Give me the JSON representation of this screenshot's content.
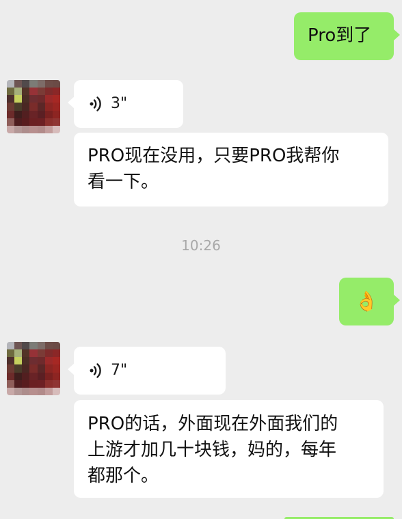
{
  "conversation": {
    "messages": [
      {
        "side": "out",
        "type": "text",
        "text": "Pro到了"
      },
      {
        "side": "in",
        "type": "voice",
        "duration": "3\""
      },
      {
        "side": "in",
        "type": "text",
        "text": "PRO现在没用，只要PRO我帮你\n看一下。"
      },
      {
        "side": "system",
        "type": "timestamp",
        "text": "10:26"
      },
      {
        "side": "out",
        "type": "emoji",
        "text": "👌"
      },
      {
        "side": "in",
        "type": "voice",
        "duration": "7\""
      },
      {
        "side": "in",
        "type": "text",
        "text": "PRO的话，外面现在外面我们的\n上游才加几十块钱，妈的，每年\n都那个。"
      }
    ]
  },
  "icons": {
    "voice": "voice-wave-icon"
  },
  "colors": {
    "background": "#ededed",
    "outgoing_bubble": "#95ec69",
    "incoming_bubble": "#ffffff",
    "timestamp": "#a8a8a8"
  }
}
